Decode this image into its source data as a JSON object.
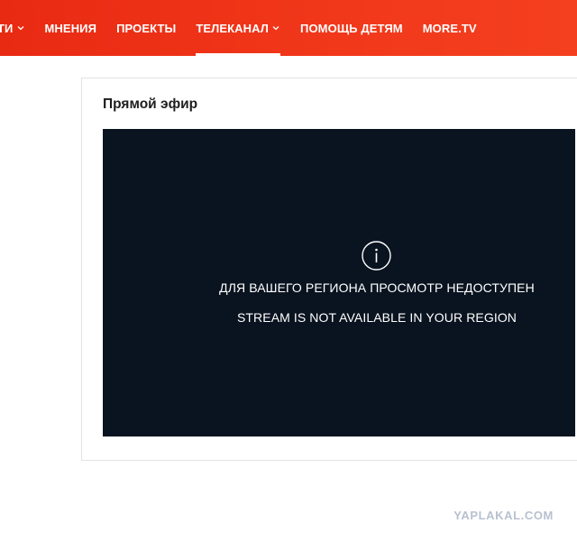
{
  "nav": {
    "items": [
      {
        "label": "ТИ",
        "dropdown": true,
        "active": false
      },
      {
        "label": "МНЕНИЯ",
        "dropdown": false,
        "active": false
      },
      {
        "label": "ПРОЕКТЫ",
        "dropdown": false,
        "active": false
      },
      {
        "label": "ТЕЛЕКАНАЛ",
        "dropdown": true,
        "active": true
      },
      {
        "label": "ПОМОЩЬ ДЕТЯМ",
        "dropdown": false,
        "active": false
      },
      {
        "label": "MORE.TV",
        "dropdown": false,
        "active": false
      }
    ],
    "colors": {
      "bar": "#ee3318",
      "text": "#ffffff"
    }
  },
  "live": {
    "title": "Прямой эфир",
    "player": {
      "background": "#0a1420",
      "icon": "info-icon",
      "message_ru": "ДЛЯ ВАШЕГО РЕГИОНА ПРОСМОТР НЕДОСТУПЕН",
      "message_en": "STREAM IS NOT AVAILABLE IN YOUR REGION"
    }
  },
  "watermark": "YAPLAKAL.COM"
}
